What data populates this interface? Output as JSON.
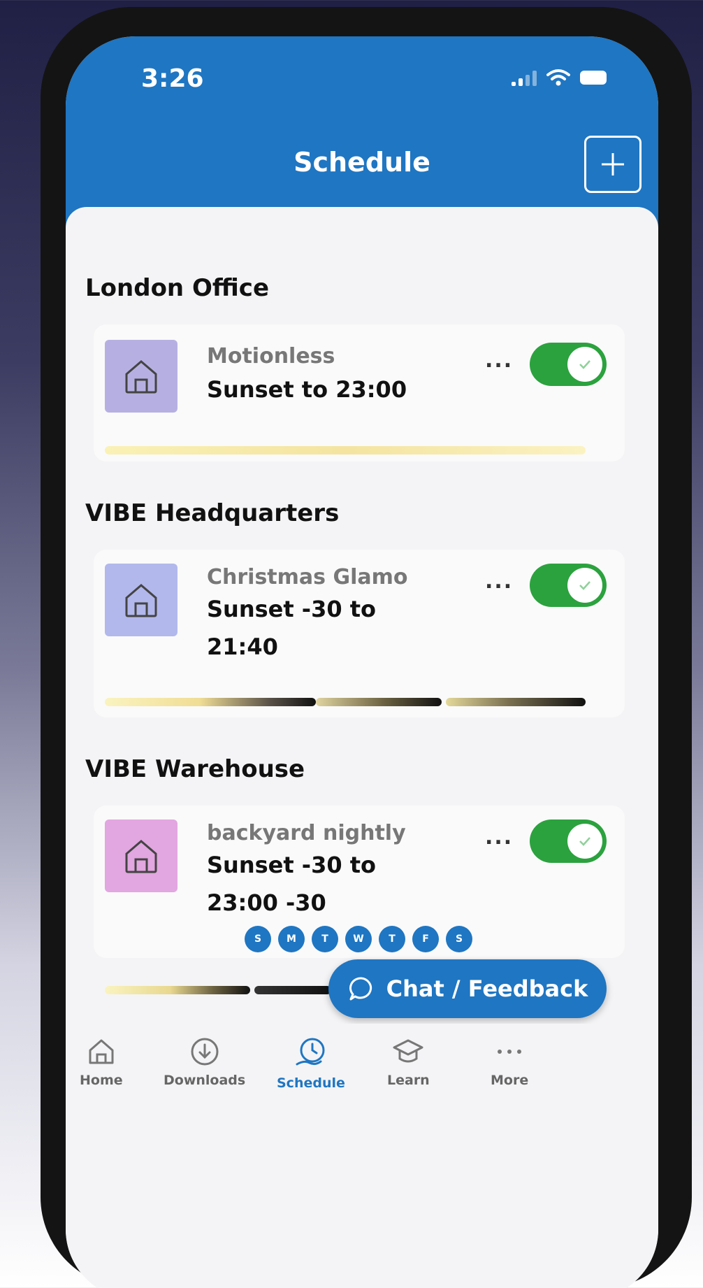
{
  "status_bar": {
    "time": "3:26"
  },
  "header": {
    "title": "Schedule"
  },
  "sections": [
    {
      "title": "London Office",
      "schedule": {
        "name": "Motionless",
        "time_line1": "Sunset  to 23:00",
        "time_line2": "",
        "enabled": true,
        "thumb_color": "#b6b0e2"
      }
    },
    {
      "title": "VIBE Headquarters",
      "schedule": {
        "name": "Christmas Glamo",
        "time_line1": "Sunset -30 to",
        "time_line2": "21:40",
        "enabled": true,
        "thumb_color": "#b2b8ec"
      }
    },
    {
      "title": "VIBE Warehouse",
      "schedule": {
        "name": "backyard nightly",
        "time_line1": "Sunset -30 to",
        "time_line2": "23:00 -30",
        "enabled": true,
        "thumb_color": "#e2a6e0"
      }
    }
  ],
  "days": [
    "S",
    "M",
    "T",
    "W",
    "T",
    "F",
    "S"
  ],
  "more_label": "...",
  "chat_button": {
    "label": "Chat / Feedback"
  },
  "nav": [
    {
      "label": "Home",
      "icon": "home-icon"
    },
    {
      "label": "Downloads",
      "icon": "download-icon"
    },
    {
      "label": "Schedule",
      "icon": "schedule-icon"
    },
    {
      "label": "Learn",
      "icon": "graduation-cap-icon"
    },
    {
      "label": "More",
      "icon": "more-dots-icon"
    }
  ],
  "colors": {
    "primary": "#1f76c2",
    "toggle_on": "#2ba23e"
  }
}
